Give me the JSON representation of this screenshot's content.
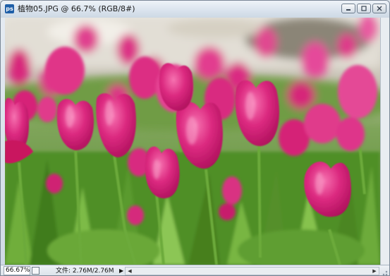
{
  "window": {
    "app_icon": "ps",
    "icon": "photoshop-document-icon",
    "title": "植物05.JPG @ 66.7% (RGB/8#)",
    "buttons": [
      "minimize-icon",
      "maximize-icon",
      "close-icon"
    ]
  },
  "canvas": {
    "image": "pink-tulip-field-photo",
    "colors": {
      "tulip": "#d81d78",
      "tulip_light": "#ef5aa2",
      "foliage": "#5e9a2f",
      "background": "#e8e4dc"
    }
  },
  "status": {
    "zoom": "66.67%",
    "doc_info": "文件: 2.76M/2.76M",
    "menu_arrow": "▶",
    "left_arrow": "◀",
    "right_arrow": "▶"
  }
}
